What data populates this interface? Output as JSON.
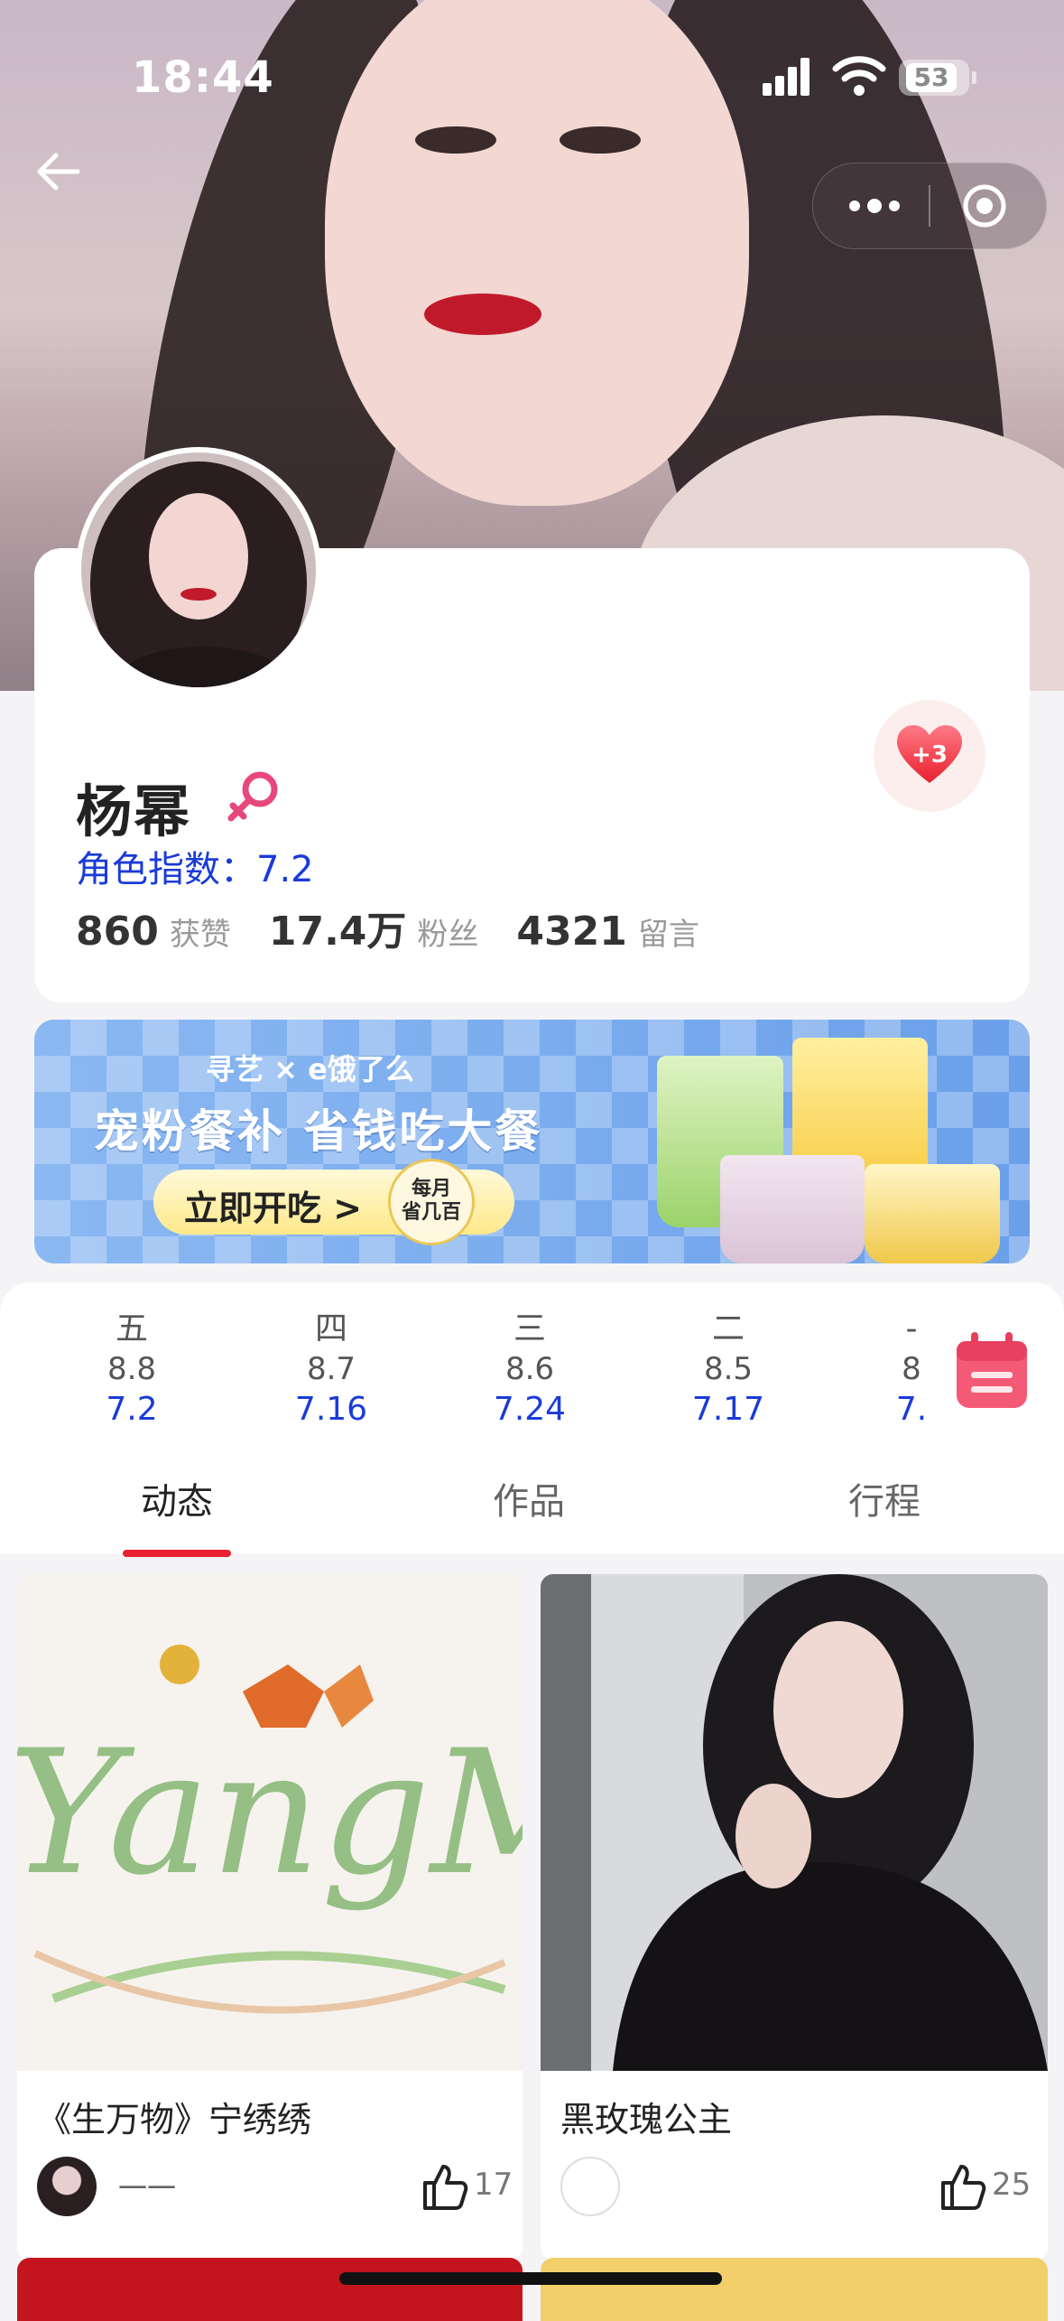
{
  "status_bar": {
    "time": "18:44",
    "battery": "53"
  },
  "profile": {
    "name": "杨幂",
    "index_label": "角色指数：7.2",
    "heart_badge": "+3",
    "stats": [
      {
        "value": "860",
        "label": "获赞"
      },
      {
        "value": "17.4万",
        "label": "粉丝"
      },
      {
        "value": "4321",
        "label": "留言"
      }
    ]
  },
  "banner": {
    "brand": "寻艺 × e饿了么",
    "title": "宠粉餐补 省钱吃大餐",
    "button": "立即开吃 >",
    "badge": "每月\n省几百"
  },
  "days": [
    {
      "weekday": "五",
      "score": "8.8",
      "date": "7.2"
    },
    {
      "weekday": "四",
      "score": "8.7",
      "date": "7.16"
    },
    {
      "weekday": "三",
      "score": "8.6",
      "date": "7.24"
    },
    {
      "weekday": "二",
      "score": "8.5",
      "date": "7.17"
    },
    {
      "weekday": "-",
      "score": "8",
      "date": "7."
    }
  ],
  "tabs": [
    "动态",
    "作品",
    "行程"
  ],
  "feed": [
    {
      "title": "《生万物》宁绣绣",
      "author": "一一",
      "likes": "17",
      "image_text": "YangMi"
    },
    {
      "title": "黑玫瑰公主",
      "author": "",
      "likes": "25"
    }
  ],
  "icons": {
    "back": "back-arrow-icon",
    "more": "more-dots-icon",
    "close": "target-icon",
    "gender": "female-icon",
    "calendar": "calendar-icon",
    "like": "thumbs-up-icon"
  },
  "colors": {
    "accent": "#e8202f",
    "link": "#1a3bd8",
    "calendar": "#f45a76"
  }
}
